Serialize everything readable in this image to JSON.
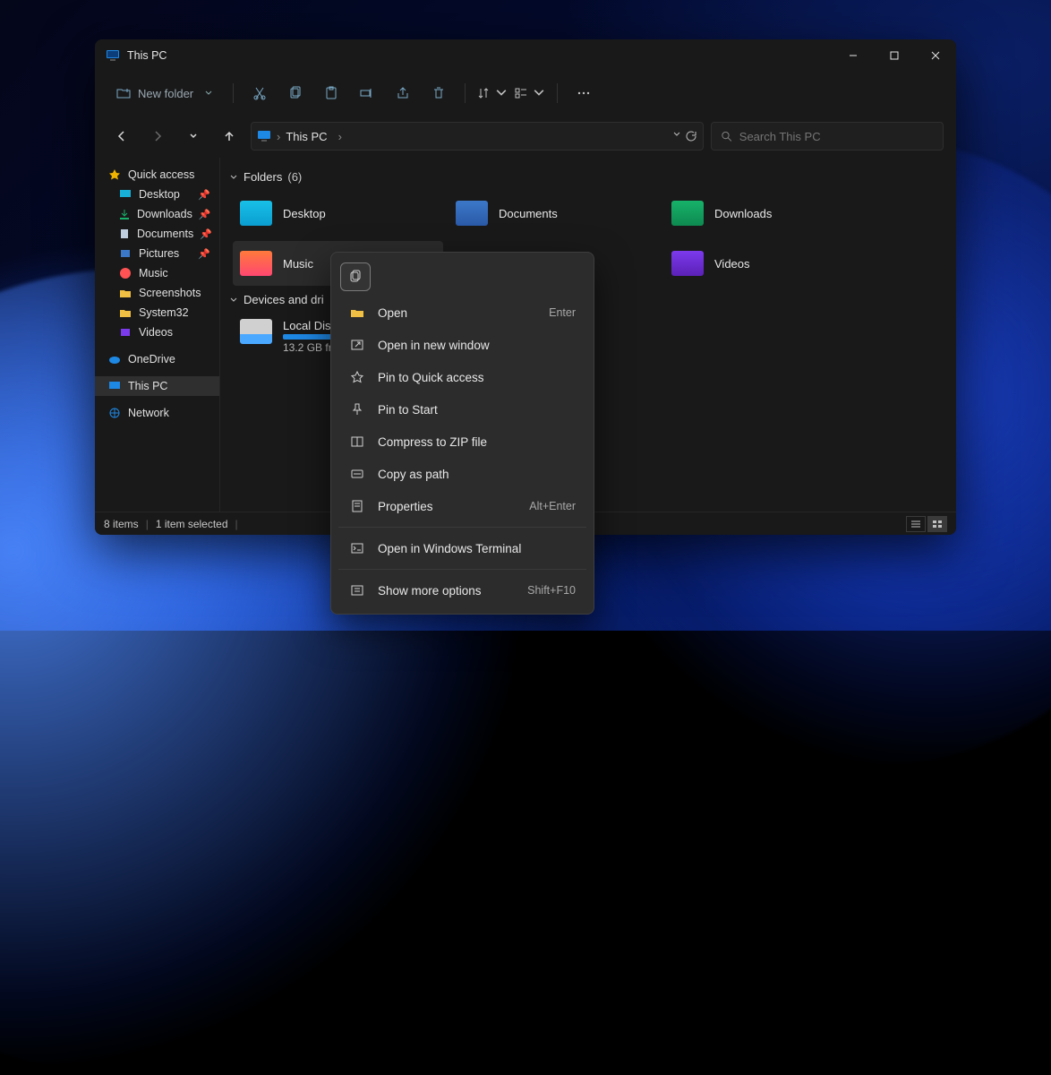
{
  "window": {
    "title": "This PC"
  },
  "toolbar": {
    "new_folder": "New folder"
  },
  "address": {
    "crumb": "This PC"
  },
  "search": {
    "placeholder": "Search This PC"
  },
  "sidebar": {
    "quick_access": "Quick access",
    "items": [
      {
        "label": "Desktop",
        "icon": "desktop",
        "pinned": true
      },
      {
        "label": "Downloads",
        "icon": "download",
        "pinned": true
      },
      {
        "label": "Documents",
        "icon": "documents",
        "pinned": true
      },
      {
        "label": "Pictures",
        "icon": "pictures",
        "pinned": true
      },
      {
        "label": "Music",
        "icon": "music",
        "pinned": false
      },
      {
        "label": "Screenshots",
        "icon": "folder",
        "pinned": false
      },
      {
        "label": "System32",
        "icon": "folder",
        "pinned": false
      },
      {
        "label": "Videos",
        "icon": "videos",
        "pinned": false
      }
    ],
    "onedrive": "OneDrive",
    "this_pc": "This PC",
    "network": "Network"
  },
  "groups": {
    "folders_label": "Folders",
    "folders_count": "(6)",
    "drives_label": "Devices and dri"
  },
  "folders": [
    {
      "label": "Desktop"
    },
    {
      "label": "Documents"
    },
    {
      "label": "Downloads"
    },
    {
      "label": "Music"
    },
    {
      "label": "Videos"
    }
  ],
  "drive": {
    "name": "Local Disk",
    "sub": "13.2 GB fr",
    "pct": 58
  },
  "status": {
    "items": "8 items",
    "selected": "1 item selected"
  },
  "ctx": {
    "open": "Open",
    "open_k": "Enter",
    "open_win": "Open in new window",
    "pin_qa": "Pin to Quick access",
    "pin_start": "Pin to Start",
    "zip": "Compress to ZIP file",
    "copy_path": "Copy as path",
    "properties": "Properties",
    "prop_k": "Alt+Enter",
    "terminal": "Open in Windows Terminal",
    "more": "Show more options",
    "more_k": "Shift+F10"
  }
}
